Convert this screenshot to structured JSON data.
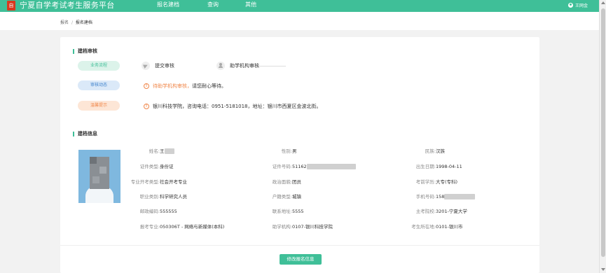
{
  "header": {
    "logo_text": "自考",
    "title": "宁夏自学考试考生服务平台",
    "nav": [
      "报名建档",
      "查询",
      "其他"
    ],
    "user_name": "王网金"
  },
  "breadcrumb": {
    "root": "报名",
    "separator": "/",
    "current": "报名建档"
  },
  "review": {
    "title": "建档审核",
    "flow_pill": "业务流程",
    "steps": [
      "提交审核",
      "助学机构审核"
    ],
    "status_pill": "审核动态",
    "status_highlight": "待助学机构审核，",
    "status_text": "请您耐心等待。",
    "notice_pill": "温馨提示",
    "notice_text": "银川科技学院，咨询电话：0951-5181018，地址：银川市西夏区金波北街。"
  },
  "info": {
    "title": "建档信息",
    "rows": [
      [
        {
          "label": "姓名:",
          "value": "王",
          "blur": 14
        },
        {
          "label": "性别:",
          "value": "男"
        },
        {
          "label": "民族:",
          "value": "汉族"
        }
      ],
      [
        {
          "label": "证件类型:",
          "value": "身份证"
        },
        {
          "label": "证件号码:",
          "value": "51162",
          "blur": 70
        },
        {
          "label": "出生日期:",
          "value": "1998-04-11"
        }
      ],
      [
        {
          "label": "专业开考类型:",
          "value": "社会开考专业"
        },
        {
          "label": "政治面貌:",
          "value": "团员"
        },
        {
          "label": "考前学历:",
          "value": "大专(专科)"
        }
      ],
      [
        {
          "label": "职业类别:",
          "value": "科学研究人员"
        },
        {
          "label": "户籍类型:",
          "value": "城镇"
        },
        {
          "label": "手机号码:",
          "value": "158",
          "blur": 44
        }
      ],
      [
        {
          "label": "邮政编码:",
          "value": "555555"
        },
        {
          "label": "联系地址:",
          "value": "5555"
        },
        {
          "label": "主考院校:",
          "value": "3201-宁夏大学"
        }
      ],
      [
        {
          "label": "报考专业:",
          "value": "050306T - 网络与新媒体(本科)"
        },
        {
          "label": "助学机构:",
          "value": "0107-银川科技学院"
        },
        {
          "label": "考生所在地:",
          "value": "0101-银川市"
        }
      ]
    ]
  },
  "buttons": {
    "edit": "修改报名信息"
  },
  "colors": {
    "primary": "#3fbf98",
    "orange": "#f0874a",
    "blue": "#3d82cc"
  }
}
